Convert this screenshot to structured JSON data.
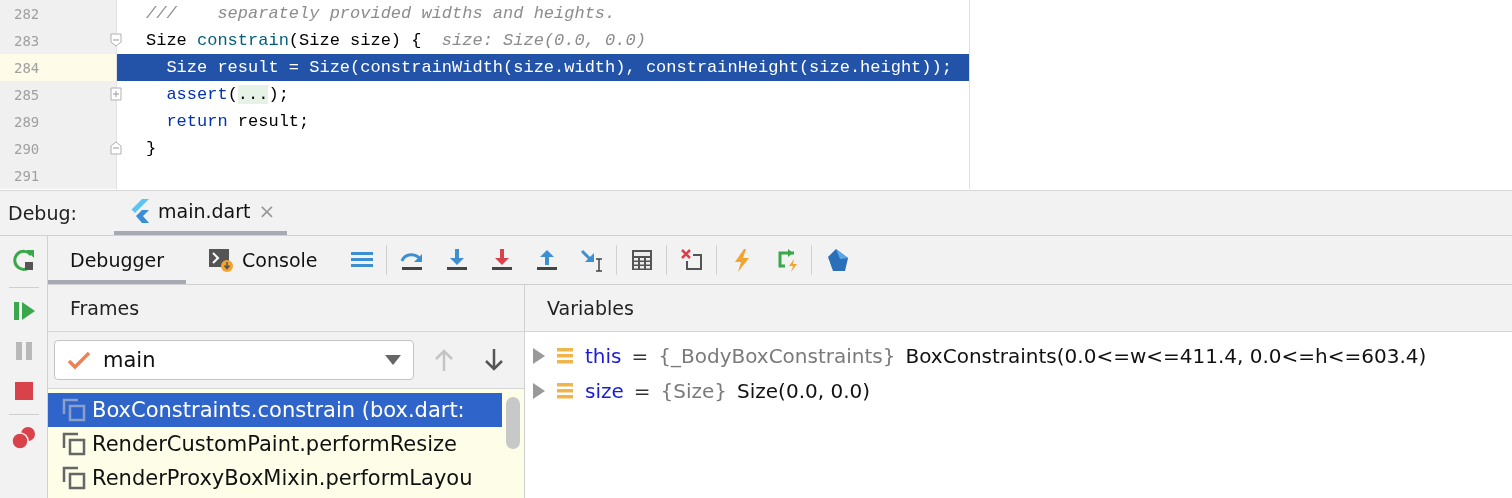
{
  "editor": {
    "lines": [
      {
        "number": "282",
        "kind": "plain",
        "current": false,
        "selected": false,
        "tokens": [
          {
            "kind": "comment",
            "text": "///    separately provided widths and heights."
          }
        ]
      },
      {
        "number": "283",
        "kind": "opener",
        "current": false,
        "selected": false,
        "tokens": [
          {
            "kind": "plain",
            "text": "Size "
          },
          {
            "kind": "method",
            "text": "constrain"
          },
          {
            "kind": "plain",
            "text": "(Size size) {"
          },
          {
            "kind": "hint",
            "text": "  size: Size(0.0, 0.0)"
          }
        ]
      },
      {
        "number": "284",
        "kind": "plain",
        "current": true,
        "selected": true,
        "tokens": [
          {
            "kind": "plain",
            "text": "  Size result = Size(constrainWidth(size.width), constrainHeight(size.height));"
          }
        ]
      },
      {
        "number": "285",
        "kind": "collapsed",
        "current": false,
        "selected": false,
        "tokens": [
          {
            "kind": "keyword",
            "text": "  assert"
          },
          {
            "kind": "plain",
            "text": "("
          },
          {
            "kind": "folded",
            "text": "..."
          },
          {
            "kind": "plain",
            "text": ");"
          }
        ]
      },
      {
        "number": "289",
        "kind": "plain",
        "current": false,
        "selected": false,
        "tokens": [
          {
            "kind": "keyword",
            "text": "  return"
          },
          {
            "kind": "plain",
            "text": " result;"
          }
        ]
      },
      {
        "number": "290",
        "kind": "closer",
        "current": false,
        "selected": false,
        "tokens": [
          {
            "kind": "plain",
            "text": "}"
          }
        ]
      },
      {
        "number": "291",
        "kind": "plain",
        "current": false,
        "selected": false
      }
    ]
  },
  "debug": {
    "label": "Debug:",
    "session_tab": {
      "title": "main.dart",
      "close": "×"
    },
    "tabs": [
      {
        "label": "Debugger",
        "kind": "plain",
        "selected": true
      },
      {
        "label": "Console",
        "kind": "console",
        "selected": false
      }
    ],
    "frames": {
      "title": "Frames",
      "thread": "main",
      "items": [
        {
          "label": "BoxConstraints.constrain (box.dart:",
          "selected": true
        },
        {
          "label": "RenderCustomPaint.performResize",
          "selected": false
        },
        {
          "label": "RenderProxyBoxMixin.performLayou",
          "selected": false
        }
      ]
    },
    "variables": {
      "title": "Variables",
      "items": [
        {
          "name": "this",
          "equals": "=",
          "type": "{_BodyBoxConstraints}",
          "value": "BoxConstraints(0.0<=w<=411.4, 0.0<=h<=603.4)"
        },
        {
          "name": "size",
          "equals": "=",
          "type": "{Size}",
          "value": "Size(0.0, 0.0)"
        }
      ]
    }
  }
}
